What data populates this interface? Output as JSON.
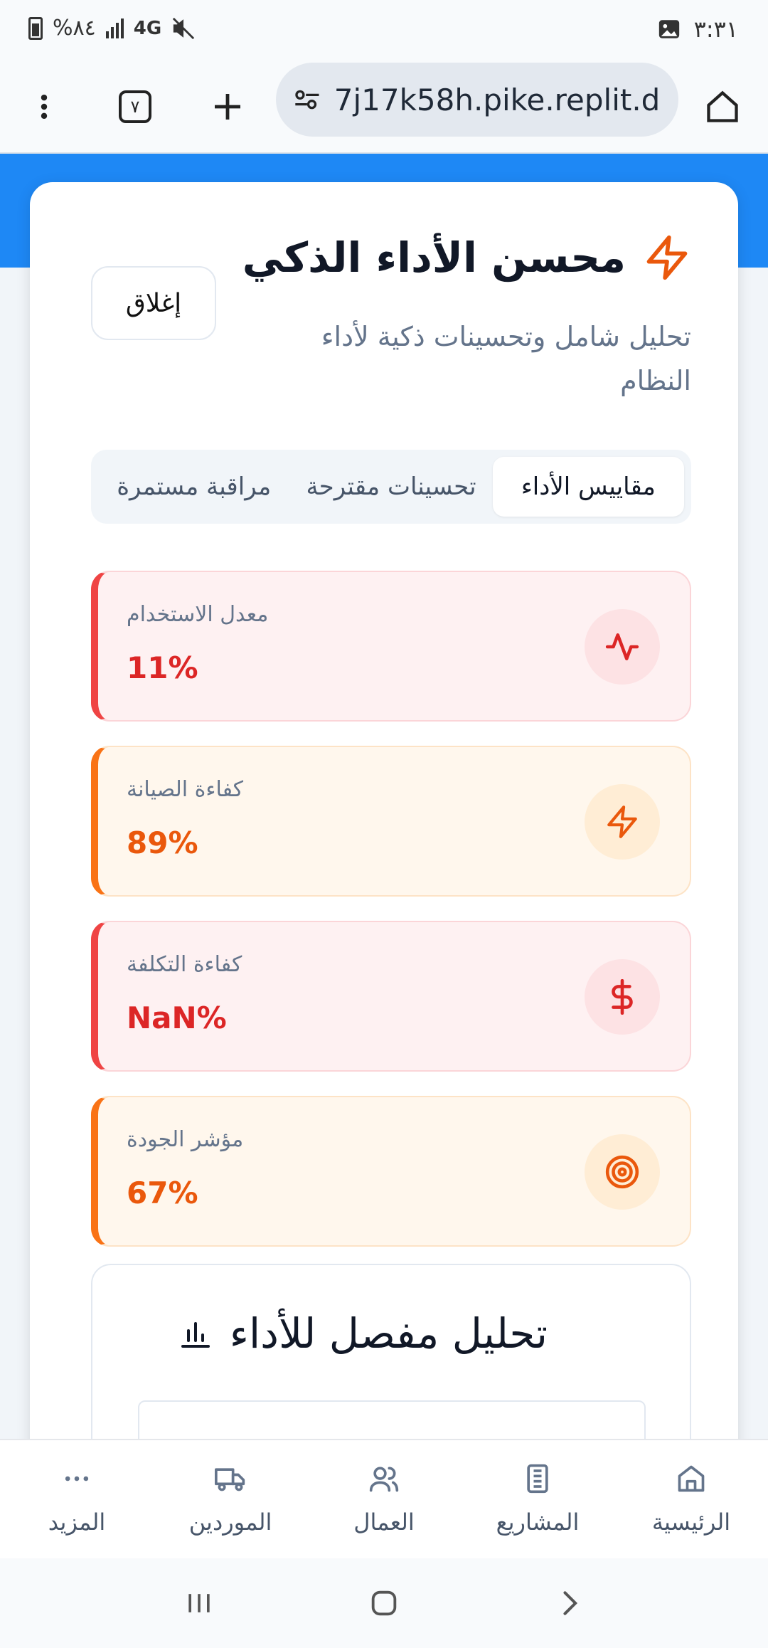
{
  "status_bar": {
    "battery": "%٨٤",
    "network": "4G",
    "time": "٣:٣١"
  },
  "browser": {
    "url": "7j17k58h.pike.replit.dev",
    "tab_count": "٧"
  },
  "dialog": {
    "title": "محسن الأداء الذكي",
    "subtitle": "تحليل شامل وتحسينات ذكية لأداء النظام",
    "close_label": "إغلاق",
    "tabs": [
      {
        "label": "مقاييس الأداء",
        "active": true
      },
      {
        "label": "تحسينات مقترحة",
        "active": false
      },
      {
        "label": "مراقبة مستمرة",
        "active": false
      }
    ],
    "metrics": [
      {
        "label": "معدل الاستخدام",
        "value": "11%",
        "icon": "activity-icon",
        "tone": "red"
      },
      {
        "label": "كفاءة الصيانة",
        "value": "89%",
        "icon": "zap-icon",
        "tone": "orange"
      },
      {
        "label": "كفاءة التكلفة",
        "value": "NaN%",
        "icon": "dollar-icon",
        "tone": "red"
      },
      {
        "label": "مؤشر الجودة",
        "value": "67%",
        "icon": "target-icon",
        "tone": "orange"
      }
    ],
    "analysis_title": "تحليل مفصل للأداء"
  },
  "bottom_nav": [
    {
      "label": "الرئيسية",
      "icon": "home-icon"
    },
    {
      "label": "المشاريع",
      "icon": "building-icon"
    },
    {
      "label": "العمال",
      "icon": "users-icon"
    },
    {
      "label": "الموردين",
      "icon": "truck-icon"
    },
    {
      "label": "المزيد",
      "icon": "more-icon"
    }
  ],
  "colors": {
    "accent_blue": "#1e88f5",
    "red": "#dc2626",
    "orange": "#ea580c"
  }
}
